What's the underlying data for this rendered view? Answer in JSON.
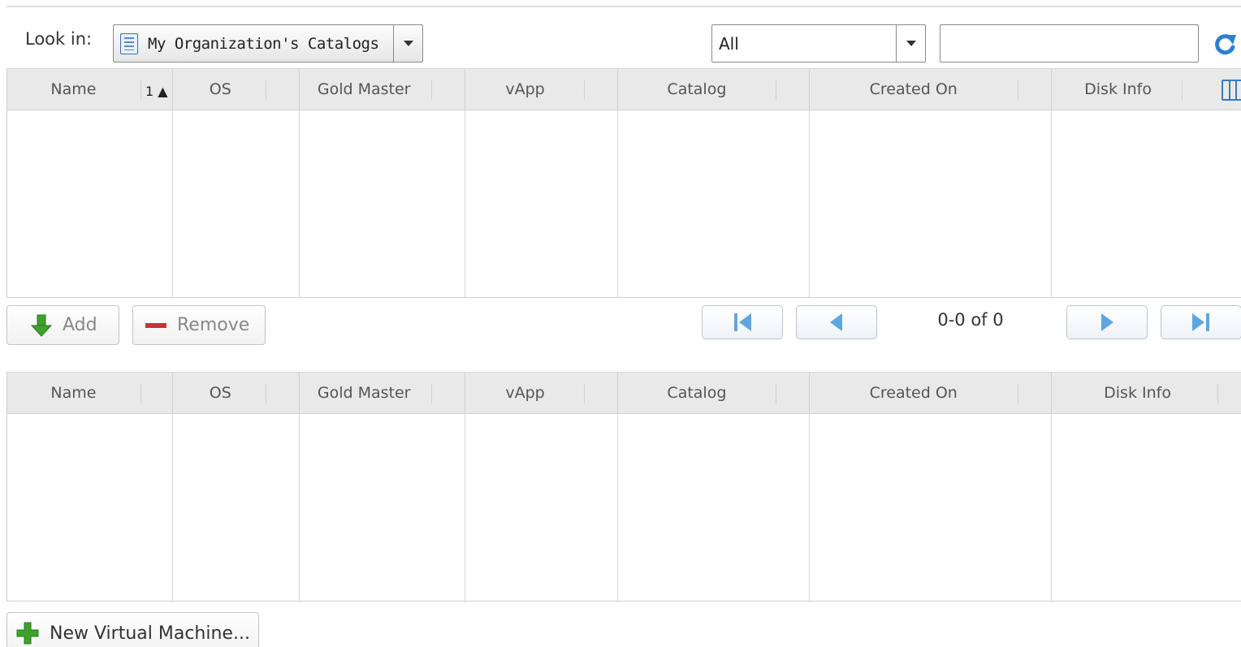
{
  "toolbar": {
    "look_in_label": "Look in:",
    "catalog_select": {
      "value": "My Organization's Catalogs"
    },
    "filter_select": {
      "value": "All"
    },
    "search": {
      "value": "",
      "placeholder": ""
    }
  },
  "available_grid": {
    "columns": [
      "Name",
      "OS",
      "Gold Master",
      "vApp",
      "Catalog",
      "Created On",
      "Disk Info"
    ],
    "sort_indicator": "1 ▲",
    "rows": []
  },
  "actions": {
    "add_label": "Add",
    "remove_label": "Remove"
  },
  "pagination": {
    "status": "0-0 of 0"
  },
  "selected_grid": {
    "columns": [
      "Name",
      "OS",
      "Gold Master",
      "vApp",
      "Catalog",
      "Created On",
      "Disk Info"
    ],
    "rows": []
  },
  "footer": {
    "new_vm_label": "New Virtual Machine..."
  },
  "colors": {
    "accent_blue": "#2f7fd0",
    "add_green": "#3fa02c",
    "remove_red": "#c8333a",
    "header_bg": "#e9e9e9"
  },
  "icons": {
    "catalog": "catalog-icon",
    "dropdown": "chevron-down-icon",
    "refresh": "refresh-icon",
    "column_picker": "columns-icon",
    "add": "arrow-down-green-icon",
    "remove": "minus-red-icon",
    "first": "first-page-icon",
    "prev": "prev-page-icon",
    "next": "next-page-icon",
    "last": "last-page-icon",
    "new_vm": "plus-green-icon"
  }
}
